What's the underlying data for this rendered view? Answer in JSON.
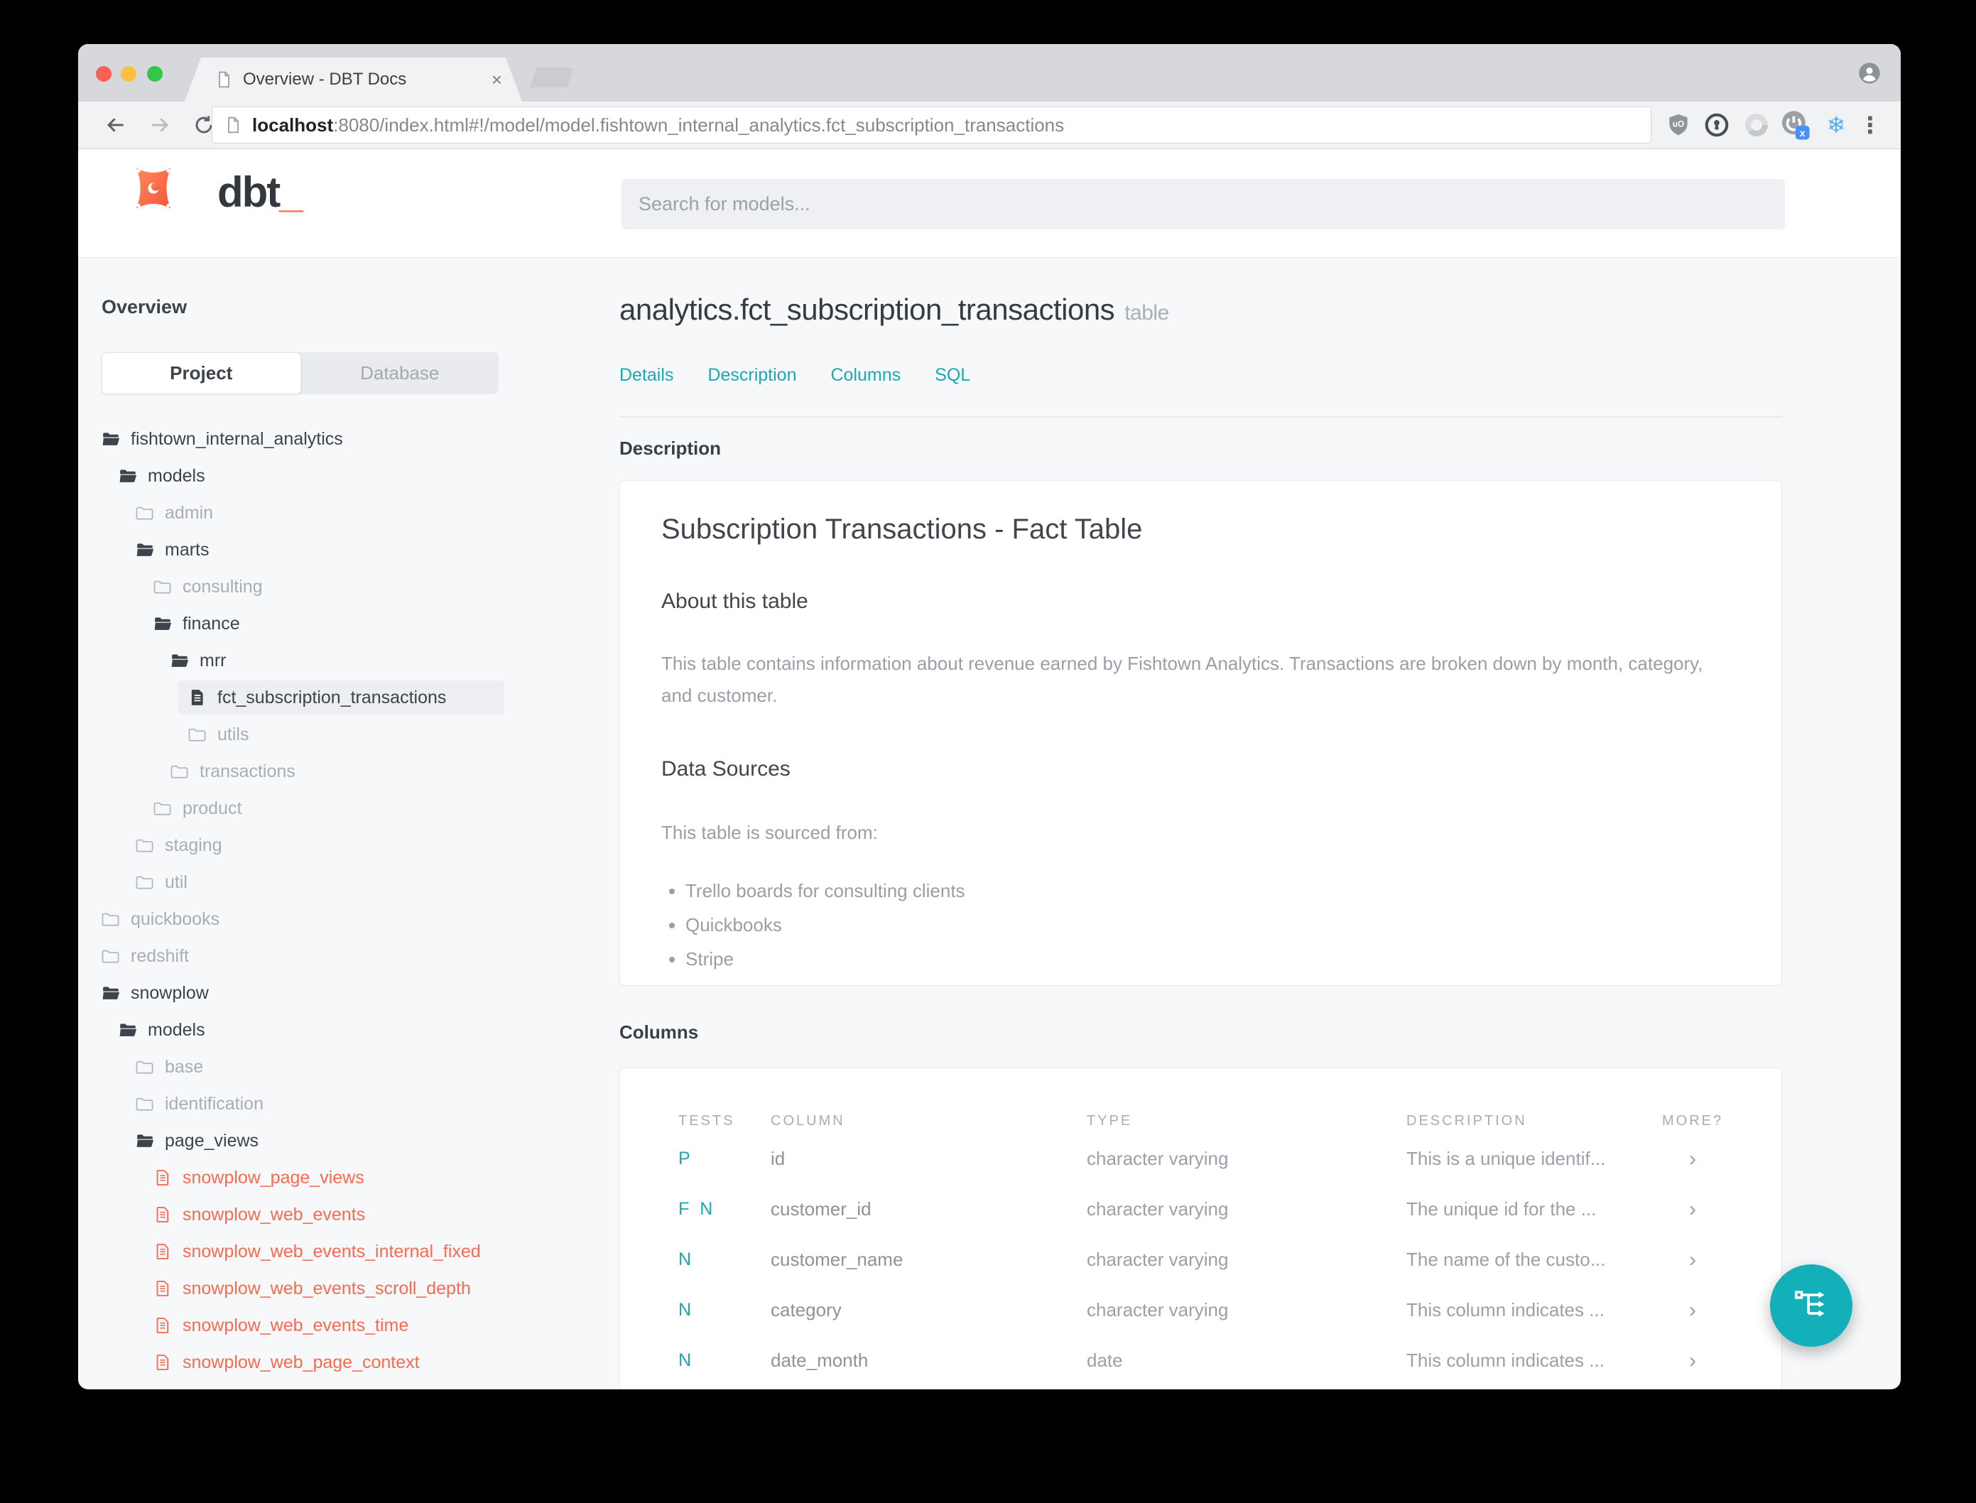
{
  "browser": {
    "tab": {
      "title": "Overview - DBT Docs",
      "close_glyph": "×"
    },
    "url": {
      "host": "localhost",
      "rest": ":8080/index.html#!/model/model.fishtown_internal_analytics.fct_subscription_transactions"
    },
    "glyphs": {
      "menu_dots": "⋮",
      "snowflake": "❄"
    }
  },
  "header": {
    "logo_text": "dbt",
    "logo_cursor": "_",
    "search_placeholder": "Search for models..."
  },
  "sidebar": {
    "overview_label": "Overview",
    "tabs": {
      "project": "Project",
      "database": "Database"
    },
    "tree": [
      {
        "label": "fishtown_internal_analytics"
      },
      {
        "label": "models"
      },
      {
        "label": "admin"
      },
      {
        "label": "marts"
      },
      {
        "label": "consulting"
      },
      {
        "label": "finance"
      },
      {
        "label": "mrr"
      },
      {
        "label": "fct_subscription_transactions"
      },
      {
        "label": "utils"
      },
      {
        "label": "transactions"
      },
      {
        "label": "product"
      },
      {
        "label": "staging"
      },
      {
        "label": "util"
      },
      {
        "label": "quickbooks"
      },
      {
        "label": "redshift"
      },
      {
        "label": "snowplow"
      },
      {
        "label": "models"
      },
      {
        "label": "base"
      },
      {
        "label": "identification"
      },
      {
        "label": "page_views"
      },
      {
        "label": "snowplow_page_views"
      },
      {
        "label": "snowplow_web_events"
      },
      {
        "label": "snowplow_web_events_internal_fixed"
      },
      {
        "label": "snowplow_web_events_scroll_depth"
      },
      {
        "label": "snowplow_web_events_time"
      },
      {
        "label": "snowplow_web_page_context"
      }
    ]
  },
  "main": {
    "title": "analytics.fct_subscription_transactions",
    "title_badge": "table",
    "nav": [
      {
        "label": "Details"
      },
      {
        "label": "Description"
      },
      {
        "label": "Columns"
      },
      {
        "label": "SQL"
      }
    ],
    "description_label": "Description",
    "doc": {
      "h1": "Subscription Transactions - Fact Table",
      "about_heading": "About this table",
      "about_text": "This table contains information about revenue earned by Fishtown Analytics. Transactions are broken down by month, category, and customer.",
      "sources_heading": "Data Sources",
      "sources_intro": "This table is sourced from:",
      "sources": [
        {
          "label": "Trello boards for consulting clients"
        },
        {
          "label": "Quickbooks"
        },
        {
          "label": "Stripe"
        }
      ]
    },
    "columns_label": "Columns",
    "table": {
      "headers": [
        "TESTS",
        "COLUMN",
        "TYPE",
        "DESCRIPTION",
        "MORE?"
      ],
      "rows": [
        {
          "tests": "P",
          "column": "id",
          "type": "character varying",
          "description": "This is a unique identif...",
          "more": "›"
        },
        {
          "tests": "F N",
          "column": "customer_id",
          "type": "character varying",
          "description": "The unique id for the ...",
          "more": "›"
        },
        {
          "tests": "N",
          "column": "customer_name",
          "type": "character varying",
          "description": "The name of the custo...",
          "more": "›"
        },
        {
          "tests": "N",
          "column": "category",
          "type": "character varying",
          "description": "This column indicates ...",
          "more": "›"
        },
        {
          "tests": "N",
          "column": "date_month",
          "type": "date",
          "description": "This column indicates ...",
          "more": "›"
        }
      ]
    }
  },
  "colors": {
    "accent_teal": "#1aa9b2",
    "fab_teal": "#14b0ba",
    "brand_orange": "#ff694b",
    "error_red": "#f96a50"
  }
}
